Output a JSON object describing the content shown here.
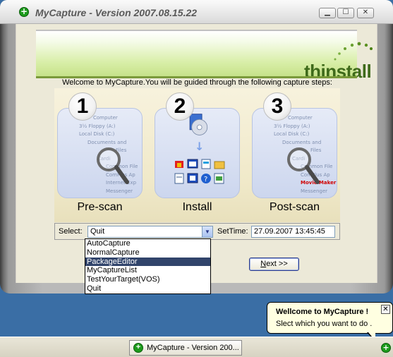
{
  "window": {
    "title": "MyCapture - Version 2007.08.15.22",
    "minimize": "▁",
    "maximize": "☐",
    "close": "✕"
  },
  "banner": {
    "logo": "thinstall"
  },
  "welcome_text": "Welcome to MyCapture.You will be guided through the following capture steps:",
  "steps": [
    {
      "number": "1",
      "label": "Pre-scan"
    },
    {
      "number": "2",
      "label": "Install"
    },
    {
      "number": "3",
      "label": "Post-scan"
    }
  ],
  "tree": {
    "computer": "Computer",
    "floppy": "3½ Floppy (A:)",
    "local_disk": "Local Disk (C:)",
    "documents": "Documents and",
    "program_files": "Files",
    "cardinal": "Cardi",
    "common_files": "Common File",
    "complus": "ComPlus Ap",
    "internet": "Internet Exp",
    "messenger": "Messenger",
    "movie_maker": "Movie Maker"
  },
  "select_row": {
    "select_label": "Select:",
    "select_value": "Quit",
    "settime_label": "SetTime:",
    "settime_value": "27.09.2007 13:45:45"
  },
  "dropdown": {
    "options": [
      "AutoCapture",
      "NormalCapture",
      "PackageEditor",
      "MyCaptureList",
      "TestYourTarget(VOS)",
      "Quit"
    ],
    "highlighted": "PackageEditor"
  },
  "next_button": {
    "label": "Next >>",
    "mnemonic": "N",
    "rest": "ext >>"
  },
  "balloon": {
    "title": "Wellcome to MyCapture !",
    "text": "Slect which you want to do .",
    "close": "✕"
  },
  "taskbar": {
    "task_label": "MyCapture - Version 200..."
  },
  "colors": {
    "desktop": "#3a6ea5",
    "selection": "#31446b",
    "logo_green": "#3e6a1a",
    "app_icon_green": "#1c9b1c"
  }
}
